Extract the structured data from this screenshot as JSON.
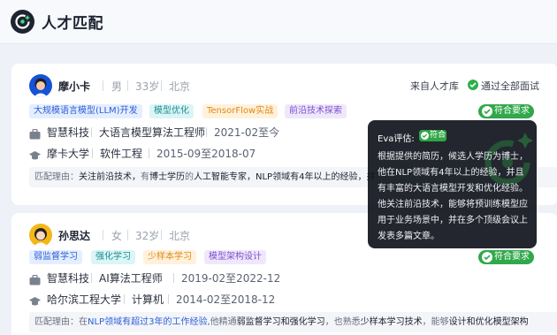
{
  "header": {
    "title": "人才匹配"
  },
  "colors": {
    "accent_green": "#31a84b",
    "tag_blue": "#2c5fd8",
    "popup_bg": "#10141c"
  },
  "candidates": [
    {
      "name": "摩小卡",
      "gender": "男",
      "age": "33岁",
      "city": "北京",
      "source": "来自人才库",
      "pass_status": "通过全部面试",
      "match_status": "符合要求",
      "tags": [
        "大规模语言模型(LLM)开发",
        "模型优化",
        "TensorFlow实战",
        "前沿技术探索"
      ],
      "work": {
        "company": "智慧科技",
        "title": "大语言模型算法工程师",
        "period": "2021-02至今"
      },
      "edu": {
        "school": "摩卡大学",
        "major": "软件工程",
        "period": "2015-09至2018-07"
      },
      "reason": {
        "label": "匹配理由：",
        "p1": "关注前沿技术，",
        "p2": "有",
        "p3": "博士学历",
        "p4": "的",
        "p5": "人工智能专家",
        "p6": "，NLP领域有4年以上的经验，并"
      }
    },
    {
      "name": "孙思达",
      "gender": "女",
      "age": "32岁",
      "city": "北京",
      "match_status": "符合要求",
      "tags": [
        "弱监督学习",
        "强化学习",
        "少样本学习",
        "模型架构设计"
      ],
      "work": {
        "company": "智慧科技",
        "title": "AI算法工程师",
        "period": "2019-02至2022-12"
      },
      "edu": {
        "school": "哈尔滨工程大学",
        "major": "计算机",
        "period": "2014-02至2018-12"
      },
      "reason": {
        "label": "匹配理由：",
        "p1": "在",
        "p2": "NLP领域有超过3年的工作经验,",
        "p3": "他精通",
        "p4": "弱监督学习和强化学习",
        "p5": "，也熟悉",
        "p6": "少样本学习技术",
        "p7": "，能够",
        "p8": "设计和优化模型架构"
      }
    }
  ],
  "popup": {
    "title": "Eva评估:",
    "badge": "符合",
    "body": "根据提供的简历，候选人学历为博士，他在NLP领域有4年以上的经验，并且有丰富的大语言模型开发和优化经验。他关注前沿技术，能够将预训练模型应用于业务场景中，并在多个顶级会议上发表多篇文章。"
  }
}
